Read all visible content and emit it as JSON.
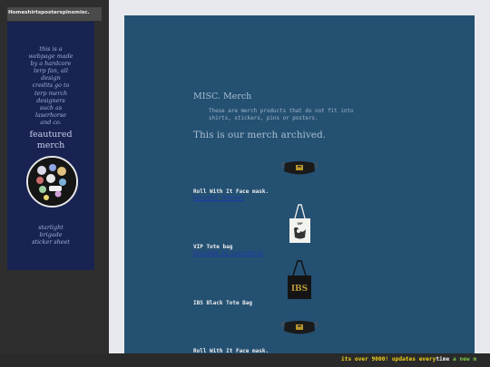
{
  "nav": {
    "links": [
      "Home",
      "shirts",
      "posters",
      "pins",
      "misc."
    ]
  },
  "sidebar": {
    "lines": [
      "this is a",
      "webpage made",
      "by a hardcore",
      "terp fan, all",
      "design",
      "credits go to",
      "terp merch",
      "designers",
      "such as",
      "laserhorse",
      "and co."
    ],
    "featured_title_line1": "feautured",
    "featured_title_line2": "merch",
    "featured_image_label": "starlight brigade sticker sheet",
    "caption_line1": "starlight",
    "caption_line2": "brigade",
    "caption_line3": "sticker sheet"
  },
  "main": {
    "title": "MISC. Merch",
    "description_line1": "These are merch products that do not fit into",
    "description_line2": "shirts, stickers, pins or posters.",
    "archived_heading": "This is our merch archived.",
    "products": [
      {
        "title": "Roll With It Face mask.",
        "link": "Designer Unknown",
        "image": "face-mask"
      },
      {
        "title": "VIP Tote bag",
        "link": "Designed by Laserhorse",
        "image": "white-tote-bag"
      },
      {
        "title": "IBS Black Tote Bag",
        "link": "",
        "image": "black-tote-bag"
      },
      {
        "title": "Roll With It Face mask.",
        "link": "",
        "image": "face-mask"
      }
    ],
    "tote_text": "IBS"
  },
  "ticker": {
    "part1": "its over 9000!",
    "part2": "updates every",
    "part3": "time",
    "part4": "a new m"
  },
  "colors": {
    "background": "#2e2e2e",
    "sidebar_panel": "#182352",
    "main_panel": "#245072",
    "page_area": "#e8e9ee",
    "ticker_yellow": "#f2d21a",
    "ticker_green": "#7ec84a"
  }
}
